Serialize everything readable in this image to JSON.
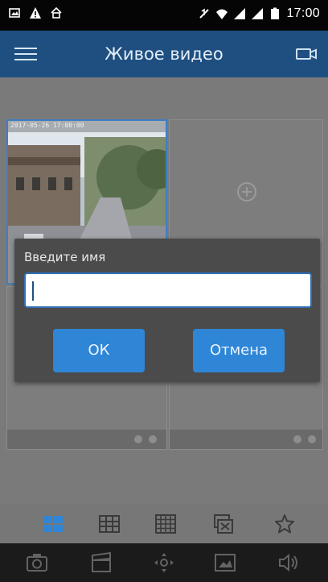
{
  "status_bar": {
    "time": "17:00",
    "left_icons": [
      "image-icon",
      "warning-icon",
      "home-icon"
    ],
    "right_icons": [
      "mute-icon",
      "wifi-icon",
      "signal-icon",
      "signal-icon",
      "battery-icon"
    ]
  },
  "app_bar": {
    "title": "Живое видео",
    "menu_icon": "menu-icon",
    "camera_icon": "camera-icon"
  },
  "live_view": {
    "cells": [
      {
        "state": "video",
        "timestamp": "2017-05-26 17:00:00"
      },
      {
        "state": "empty",
        "icon": "add-icon"
      },
      {
        "state": "empty"
      },
      {
        "state": "empty"
      }
    ]
  },
  "dialog": {
    "title": "Введите имя",
    "input": {
      "value": "",
      "placeholder": ""
    },
    "ok_label": "ОК",
    "cancel_label": "Отмена"
  },
  "layout_bar": {
    "items": [
      "layout-2x2-icon",
      "layout-3x3-icon",
      "layout-4x4-icon",
      "close-all-icon",
      "favorite-icon"
    ],
    "selected_index": 0
  },
  "action_bar": {
    "items": [
      "snapshot-icon",
      "record-icon",
      "ptz-icon",
      "playback-icon",
      "audio-icon"
    ]
  },
  "colors": {
    "app_bar": "#1e4f80",
    "accent": "#2f86d6",
    "dialog_bg": "#4b4b4b",
    "status_bar": "#050505"
  }
}
